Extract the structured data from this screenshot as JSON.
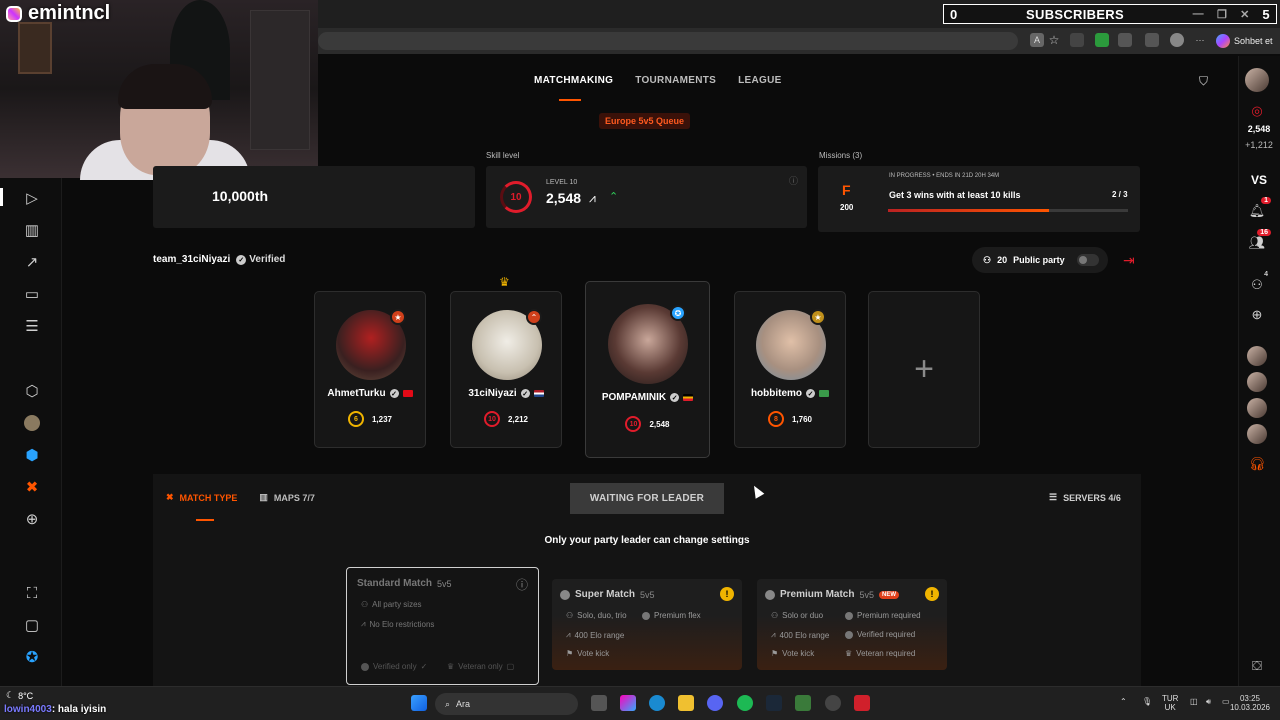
{
  "stream": {
    "channel": "emintncl",
    "subscribers_left": "0",
    "subscribers_label": "SUBSCRIBERS",
    "subscribers_right": "5"
  },
  "browser": {
    "chat_button": "Sohbet et"
  },
  "nav": {
    "tabs": [
      "MATCHMAKING",
      "TOURNAMENTS",
      "LEAGUE"
    ],
    "active_tab": "MATCHMAKING",
    "queue": "Europe 5v5 Queue"
  },
  "stats": {
    "rank_value": "10,000th",
    "skill_label": "Skill level",
    "skill_level_text": "LEVEL 10",
    "skill_level_num": "10",
    "skill_elo": "2,548",
    "missions_label": "Missions (3)",
    "mission_badge": "F",
    "mission_points": "200",
    "mission_status": "IN PROGRESS • ENDS IN 21D 20H 34M",
    "mission_title": "Get 3 wins with at least 10 kills",
    "mission_progress": "2 / 3",
    "mission_progress_fraction": 0.67
  },
  "party": {
    "team_name": "team_31ciNiyazi",
    "verified_label": "Verified",
    "party_size": "20",
    "public_party_label": "Public party",
    "members": [
      {
        "name": "AhmetTurku",
        "level": "6",
        "elo": "1,237",
        "flag_color": "#e30a17"
      },
      {
        "name": "31ciNiyazi",
        "level": "10",
        "elo": "2,212",
        "flag_color": "#21468b"
      },
      {
        "name": "POMPAMINIK",
        "level": "10",
        "elo": "2,548",
        "flag_color": "#f0b400"
      },
      {
        "name": "hobbitemo",
        "level": "8",
        "elo": "1,760",
        "flag_color": "#3a9a4a"
      }
    ],
    "add_symbol": "+"
  },
  "settings": {
    "tab_match_type": "MATCH TYPE",
    "tab_maps": "MAPS 7/7",
    "waiting_label": "WAITING FOR LEADER",
    "servers_label": "SERVERS 4/6",
    "leader_note": "Only your party leader can change settings",
    "matches": [
      {
        "title": "Standard Match",
        "mode": "5v5",
        "features": [
          "All party sizes",
          "No Elo restrictions"
        ],
        "footer": [
          "Verified only",
          "Veteran only"
        ]
      },
      {
        "title": "Super Match",
        "mode": "5v5",
        "features": [
          "Solo, duo, trio",
          "Premium flex",
          "400 Elo range",
          "Vote kick"
        ]
      },
      {
        "title": "Premium Match",
        "mode": "5v5",
        "new_badge": "NEW",
        "features": [
          "Solo or duo",
          "Premium required",
          "400 Elo range",
          "Verified required",
          "Vote kick",
          "Veteran required"
        ]
      }
    ]
  },
  "right_sidebar": {
    "elo": "2,548",
    "elo_delta": "+1,212",
    "vs_label": "VS",
    "notif_count": "1",
    "friends_count": "16",
    "party_count": "4"
  },
  "taskbar": {
    "weather": "8°C",
    "search_placeholder": "Ara",
    "lang_top": "TUR",
    "lang_bottom": "UK",
    "time": "03:25",
    "date": "10.03.2026"
  },
  "chat_overlay": {
    "user": "lowin4003",
    "message": ": hala iyisin"
  }
}
